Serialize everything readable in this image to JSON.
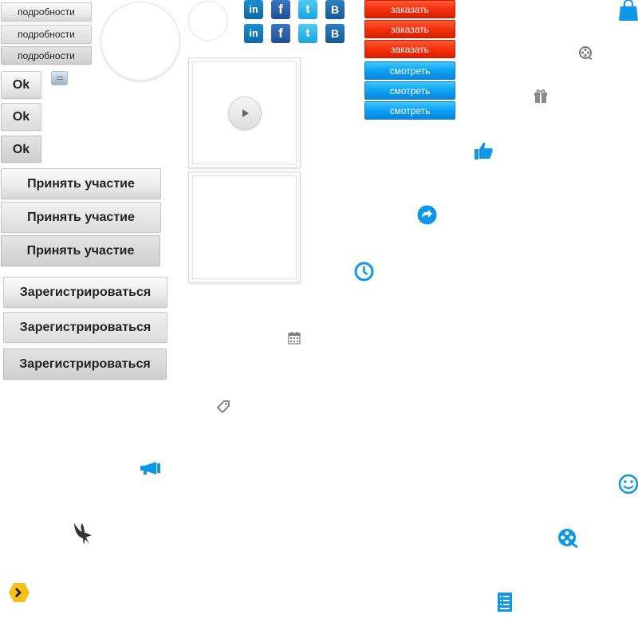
{
  "buttons": {
    "details": [
      "подробности",
      "подробности",
      "подробности"
    ],
    "ok": [
      "Ok",
      "Ok",
      "Ok"
    ],
    "participate": [
      "Принять  участие",
      "Принять  участие",
      "Принять  участие"
    ],
    "register": [
      "Зарегистрироваться",
      "Зарегистрироваться",
      "Зарегистрироваться"
    ],
    "order": [
      "заказать",
      "заказать",
      "заказать"
    ],
    "watch": [
      "смотреть",
      "смотреть",
      "смотреть"
    ]
  },
  "social": {
    "linkedin": "in",
    "facebook": "f",
    "twitter": "t",
    "vk": "B"
  },
  "colors": {
    "accent_blue": "#0e96e8",
    "order_red": "#f2310d",
    "watch_blue": "#0da2f3",
    "icon_gray": "#7a7a7a",
    "badge_yellow": "#f6c018"
  },
  "icons": [
    "small-button-icon",
    "play-icon",
    "shopping-bag-icon",
    "film-reel-icon",
    "gift-icon",
    "thumbs-up-icon",
    "refresh-arrow-icon",
    "clock-icon",
    "calendar-icon",
    "tag-icon",
    "megaphone-icon",
    "bird-logo-icon",
    "hexagon-arrow-icon",
    "smiley-icon",
    "film-reel-blue-icon",
    "document-list-icon"
  ]
}
